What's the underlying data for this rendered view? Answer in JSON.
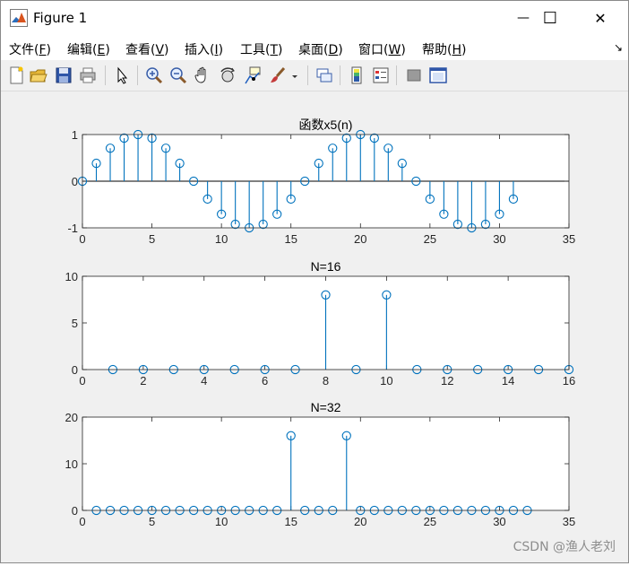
{
  "window": {
    "title": "Figure 1",
    "minimize_glyph": "—",
    "maximize_glyph": "☐",
    "close_glyph": "✕"
  },
  "menu": [
    {
      "label": "文件(",
      "key": "F",
      "suffix": ")"
    },
    {
      "label": "编辑(",
      "key": "E",
      "suffix": ")"
    },
    {
      "label": "查看(",
      "key": "V",
      "suffix": ")"
    },
    {
      "label": "插入(",
      "key": "I",
      "suffix": ")"
    },
    {
      "label": "工具(",
      "key": "T",
      "suffix": ")"
    },
    {
      "label": "桌面(",
      "key": "D",
      "suffix": ")"
    },
    {
      "label": "窗口(",
      "key": "W",
      "suffix": ")"
    },
    {
      "label": "帮助(",
      "key": "H",
      "suffix": ")"
    }
  ],
  "menu_dock_glyph": "↘",
  "toolbar": [
    {
      "name": "new-figure-icon"
    },
    {
      "name": "open-file-icon"
    },
    {
      "name": "save-icon"
    },
    {
      "name": "print-icon"
    },
    {
      "name": "edit-plot-arrow-icon"
    },
    {
      "name": "zoom-in-icon"
    },
    {
      "name": "zoom-out-icon"
    },
    {
      "name": "pan-hand-icon"
    },
    {
      "name": "rotate-3d-icon"
    },
    {
      "name": "data-cursor-icon"
    },
    {
      "name": "brush-icon"
    },
    {
      "name": "brush-dropdown-icon"
    },
    {
      "name": "link-plot-icon"
    },
    {
      "name": "colorbar-icon"
    },
    {
      "name": "legend-icon"
    },
    {
      "name": "hide-plot-tools-icon"
    },
    {
      "name": "show-plot-tools-icon"
    }
  ],
  "colors": {
    "stem": "#0072BD",
    "axes_bg": "#ffffff",
    "figure_bg": "#f0f0f0"
  },
  "chart_data": [
    {
      "type": "stem",
      "title": "函数x5(n)",
      "xlim": [
        0,
        35
      ],
      "ylim": [
        -1,
        1
      ],
      "xticks": [
        0,
        5,
        10,
        15,
        20,
        25,
        30,
        35
      ],
      "yticks": [
        -1,
        0,
        1
      ],
      "baseline": 0,
      "x": [
        0,
        1,
        2,
        3,
        4,
        5,
        6,
        7,
        8,
        9,
        10,
        11,
        12,
        13,
        14,
        15,
        16,
        17,
        18,
        19,
        20,
        21,
        22,
        23,
        24,
        25,
        26,
        27,
        28,
        29,
        30,
        31
      ],
      "y": [
        0,
        0.383,
        0.707,
        0.924,
        1,
        0.924,
        0.707,
        0.383,
        0,
        -0.383,
        -0.707,
        -0.924,
        -1,
        -0.924,
        -0.707,
        -0.383,
        0,
        0.383,
        0.707,
        0.924,
        1,
        0.924,
        0.707,
        0.383,
        0,
        -0.383,
        -0.707,
        -0.924,
        -1,
        -0.924,
        -0.707,
        -0.383
      ]
    },
    {
      "type": "stem",
      "title": "N=16",
      "xlim": [
        0,
        16
      ],
      "ylim": [
        0,
        10
      ],
      "xticks": [
        0,
        2,
        4,
        6,
        8,
        10,
        12,
        14,
        16
      ],
      "yticks": [
        0,
        5,
        10
      ],
      "baseline": 0,
      "x": [
        1,
        2,
        3,
        4,
        5,
        6,
        7,
        8,
        9,
        10,
        11,
        12,
        13,
        14,
        15,
        16
      ],
      "y": [
        0,
        0,
        0,
        0,
        0,
        0,
        0,
        8,
        0,
        8,
        0,
        0,
        0,
        0,
        0,
        0
      ]
    },
    {
      "type": "stem",
      "title": "N=32",
      "xlim": [
        0,
        35
      ],
      "ylim": [
        0,
        20
      ],
      "xticks": [
        0,
        5,
        10,
        15,
        20,
        25,
        30,
        35
      ],
      "yticks": [
        0,
        10,
        20
      ],
      "baseline": 0,
      "x": [
        1,
        2,
        3,
        4,
        5,
        6,
        7,
        8,
        9,
        10,
        11,
        12,
        13,
        14,
        15,
        16,
        17,
        18,
        19,
        20,
        21,
        22,
        23,
        24,
        25,
        26,
        27,
        28,
        29,
        30,
        31,
        32
      ],
      "y": [
        0,
        0,
        0,
        0,
        0,
        0,
        0,
        0,
        0,
        0,
        0,
        0,
        0,
        0,
        16,
        0,
        0,
        0,
        16,
        0,
        0,
        0,
        0,
        0,
        0,
        0,
        0,
        0,
        0,
        0,
        0,
        0
      ]
    }
  ],
  "watermark": "CSDN @渔人老刘"
}
